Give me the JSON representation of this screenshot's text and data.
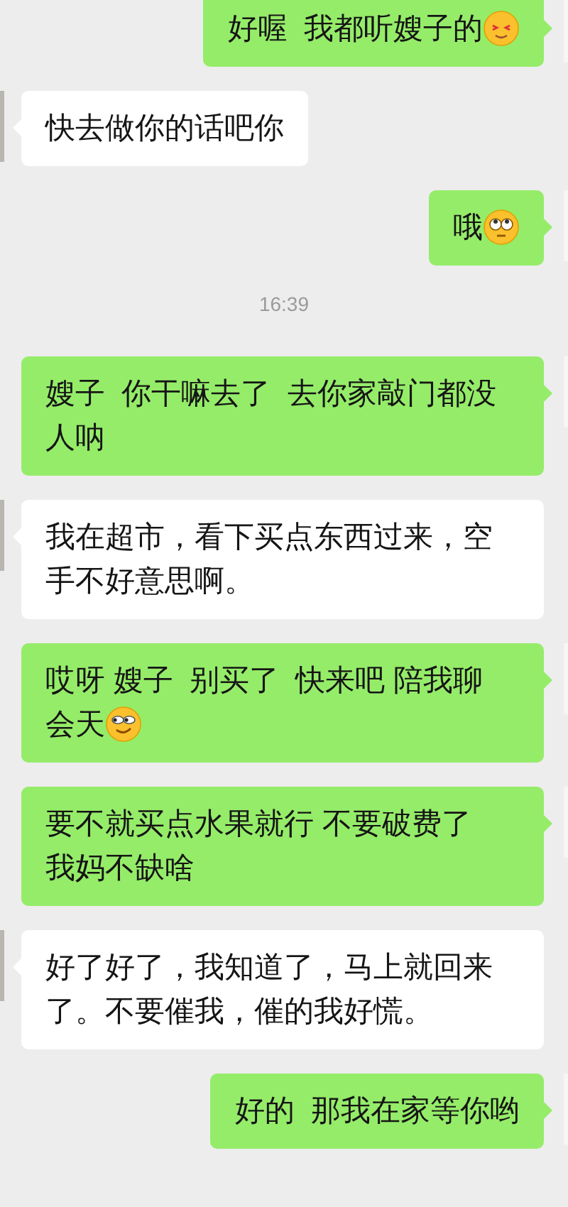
{
  "messages": [
    {
      "kind": "sent",
      "lines": [
        "好喔  我都听嫂子的"
      ],
      "emoji": {
        "kind": "blush"
      }
    },
    {
      "kind": "received",
      "lines": [
        "快去做你的话吧你"
      ]
    },
    {
      "kind": "sent",
      "lines": [
        "哦"
      ],
      "emoji": {
        "kind": "eyeroll"
      }
    },
    {
      "kind": "time",
      "text": "16:39"
    },
    {
      "kind": "sent",
      "lines": [
        "嫂子  你干嘛去了  去你家敲门都没",
        "人呐"
      ]
    },
    {
      "kind": "received",
      "lines": [
        "我在超市，看下买点东西过来，空",
        "手不好意思啊。"
      ]
    },
    {
      "kind": "sent",
      "lines": [
        "哎呀 嫂子  别买了  快来吧 陪我聊",
        "会天"
      ],
      "emoji": {
        "kind": "smirk"
      }
    },
    {
      "kind": "sent",
      "lines": [
        "要不就买点水果就行 不要破费了",
        "我妈不缺啥"
      ]
    },
    {
      "kind": "received",
      "lines": [
        "好了好了，我知道了，马上就回来",
        "了。不要催我，催的我好慌。"
      ]
    },
    {
      "kind": "sent",
      "lines": [
        "好的  那我在家等你哟"
      ]
    }
  ]
}
